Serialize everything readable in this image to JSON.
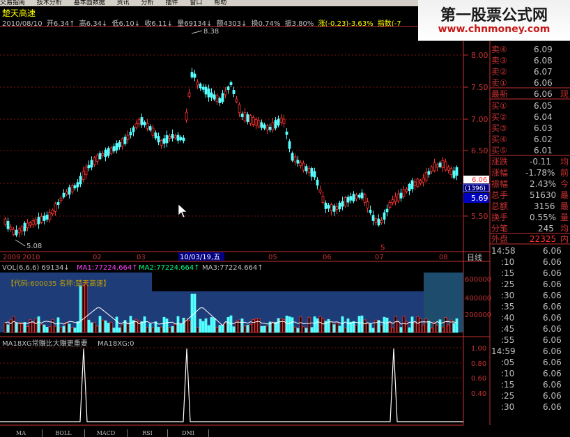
{
  "menu": {
    "items": [
      "交易指南",
      "技术分析",
      "基本面数据",
      "资讯",
      "分析",
      "插件",
      "窗口",
      "帮助"
    ]
  },
  "brand": {
    "title": "第一股票公式网",
    "url": "www.chnmoney.com"
  },
  "stock": {
    "name": "楚天高速",
    "code": "600035",
    "info_label": "【代码:600035 名称:楚天高速】"
  },
  "quote": {
    "date": "2010/08/10",
    "open": "开6.34↑",
    "high": "高6.34↓",
    "low": "低6.10↓",
    "close": "收6.11↓",
    "volume": "量69134↓",
    "amount": "额4303↓",
    "turnover": "换0.74%",
    "amplitude": "振3.80%",
    "change": "涨(-0.23)-3.63%",
    "index": "指数(-7"
  },
  "price_axis": {
    "labels": [
      "8.00",
      "7.50",
      "7.00",
      "6.50",
      "6.00",
      "5.50"
    ]
  },
  "price_markers": {
    "high": "8.38",
    "low": "5.08",
    "current": "6.06",
    "volume_box": "(1396)",
    "sub_price": "5.69"
  },
  "time_axis": {
    "labels": [
      "2009",
      "2010",
      "02",
      "03",
      "10/03/19,五",
      "05",
      "06",
      "07",
      "08"
    ],
    "right_label": "日线",
    "s_marker": "S"
  },
  "vol_header": {
    "vol": "VOL(6,6,6) 69134↓",
    "ma1": "MA1:77224.664↑",
    "ma2": "MA2:77224.664↑",
    "ma3": "MA3:77224.664↑"
  },
  "vol_axis": {
    "labels": [
      "600000",
      "400000",
      "200000"
    ]
  },
  "ind_header": {
    "title": "MA18XG常赚比大赚更重要",
    "value": "MA18XG:0"
  },
  "ind_axis": {
    "labels": [
      "1.00",
      "0.80",
      "0.60",
      "0.40"
    ]
  },
  "order_book": {
    "sell": [
      {
        "label": "卖④",
        "price": "6.09"
      },
      {
        "label": "卖③",
        "price": "6.08"
      },
      {
        "label": "卖②",
        "price": "6.07"
      },
      {
        "label": "卖①",
        "price": "6.06"
      }
    ],
    "latest": {
      "label": "最新",
      "price": "6.06",
      "extra": "现"
    },
    "buy": [
      {
        "label": "买①",
        "price": "6.05"
      },
      {
        "label": "买②",
        "price": "6.04"
      },
      {
        "label": "买③",
        "price": "6.03"
      },
      {
        "label": "买④",
        "price": "6.02"
      },
      {
        "label": "买⑤",
        "price": "6.01"
      }
    ]
  },
  "stats": [
    {
      "label": "涨跌",
      "value": "-0.11",
      "extra": "均"
    },
    {
      "label": "涨幅",
      "value": "-1.78%",
      "extra": "前"
    },
    {
      "label": "振幅",
      "value": "2.43%",
      "extra": "今"
    },
    {
      "label": "总手",
      "value": "51630",
      "extra": "最"
    },
    {
      "label": "总额",
      "value": "3156",
      "extra": "最"
    },
    {
      "label": "换手",
      "value": "0.55%",
      "extra": "量"
    },
    {
      "label": "分笔",
      "value": "245",
      "extra": "均"
    }
  ],
  "outer_disk": {
    "label": "外盘",
    "value": "22325",
    "extra": "内"
  },
  "ticks": [
    {
      "time": "14:58",
      "price": "6.06"
    },
    {
      "time": ":10",
      "price": "6.06"
    },
    {
      "time": ":15",
      "price": "6.06"
    },
    {
      "time": ":25",
      "price": "6.06"
    },
    {
      "time": ":30",
      "price": "6.06"
    },
    {
      "time": ":35",
      "price": "6.06"
    },
    {
      "time": ":40",
      "price": "6.06"
    },
    {
      "time": ":45",
      "price": "6.06"
    },
    {
      "time": ":55",
      "price": "6.06"
    },
    {
      "time": "14:59",
      "price": "6.06"
    },
    {
      "time": ":05",
      "price": "6.06"
    },
    {
      "time": ":10",
      "price": "6.06"
    },
    {
      "time": ":15",
      "price": "6.06"
    },
    {
      "time": ":25",
      "price": "6.06"
    },
    {
      "time": ":30",
      "price": "6.06"
    }
  ],
  "tabs": [
    "MA",
    "BOLL",
    "MACD",
    "RSI",
    "DMI"
  ],
  "colors": {
    "up": "#ff3232",
    "down": "#54ffff",
    "grid": "#800000",
    "axis": "#c83232",
    "ma": "#ffffff"
  }
}
